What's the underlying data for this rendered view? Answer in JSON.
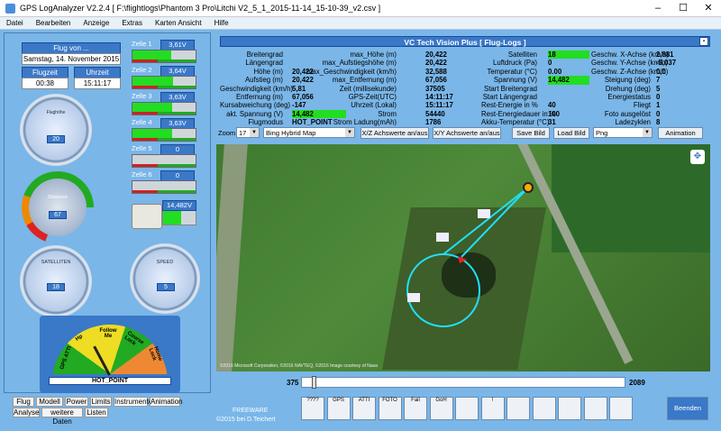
{
  "window": {
    "title": "GPS LogAnalyzer V2.2.4   [ F:\\flightlogs\\Phantom 3 Pro\\Litchi V2_5_1_2015-11-14_15-10-39_v2.csv ]"
  },
  "menu": [
    "Datei",
    "Bearbeiten",
    "Anzeige",
    "Extras",
    "Karten Ansicht",
    "Hilfe"
  ],
  "flight": {
    "header": "Flug von ...",
    "date": "Samstag, 14. November 2015",
    "flugzeit_label": "Flugzeit",
    "uhrzeit_label": "Uhrzeit",
    "flugzeit": "00:38",
    "uhrzeit": "15:11:17"
  },
  "cells": [
    {
      "label": "Zelle 1",
      "value": "3,61V",
      "level": 0.62
    },
    {
      "label": "Zelle 2",
      "value": "3,64V",
      "level": 0.64
    },
    {
      "label": "Zelle 3",
      "value": "3,63V",
      "level": 0.63
    },
    {
      "label": "Zelle 4",
      "value": "3,63V",
      "level": 0.63
    },
    {
      "label": "Zelle 5",
      "value": "0",
      "level": 0
    },
    {
      "label": "Zelle 6",
      "value": "0",
      "level": 0
    }
  ],
  "battery": {
    "value": "14,482V"
  },
  "gauges": {
    "speed_small": {
      "label": "Flughöhe",
      "value": "20"
    },
    "distance": {
      "label": "Distance",
      "value": "67"
    },
    "satellites": {
      "label": "SATELLITEN",
      "value": "18"
    },
    "speed": {
      "label": "SPEED",
      "value": "5"
    }
  },
  "mode": {
    "labels": [
      "GPS ATTI",
      "Hp",
      "Follow Me",
      "Course Lock",
      "Home Lock"
    ],
    "value": "HOT_POINT"
  },
  "tabs_row1": [
    "Flug",
    "Modell",
    "Power",
    "Limits",
    "Instrumente",
    "Animation"
  ],
  "tabs_row2": [
    "Analyse",
    "weitere Daten",
    "Listen"
  ],
  "vc_header": "VC Tech Vision Plus [ Flug-Logs ]",
  "col1": [
    [
      "Breitengrad",
      ""
    ],
    [
      "Längengrad",
      ""
    ],
    [
      "Höhe (m)",
      "20,422"
    ],
    [
      "Aufstieg (m)",
      "20,422"
    ],
    [
      "Geschwindigkeit (km/h)",
      "5,81"
    ],
    [
      "Entfernung (m)",
      "67,056"
    ],
    [
      "Kursabweichung (deg)",
      "-147"
    ],
    [
      "akt. Spannung (V)",
      "14,482"
    ],
    [
      "Flugmodus",
      "HOT_POINT"
    ]
  ],
  "col2": [
    [
      "max_Höhe (m)",
      "20,422"
    ],
    [
      "max_Aufstiegshöhe (m)",
      "20,422"
    ],
    [
      "max_Geschwindigkeit (km/h)",
      "32,588"
    ],
    [
      "max_Entfernung (m)",
      "67,056"
    ],
    [
      "Zeit (millisekunde)",
      "37505"
    ],
    [
      "GPS-Zeit(UTC)",
      "14:11:17"
    ],
    [
      "Uhrzeit (Lokal)",
      "15:11:17"
    ],
    [
      "Strom",
      "54440"
    ],
    [
      "Strom Ladung(mAh)",
      "1786"
    ]
  ],
  "col3": [
    [
      "Satelliten",
      "18"
    ],
    [
      "Luftdruck (Pa)",
      "0"
    ],
    [
      "Temperatur (°C)",
      "0.00"
    ],
    [
      "Spannung (V)",
      "14,482"
    ],
    [
      "Start Breitengrad",
      ""
    ],
    [
      "Start Längengrad",
      ""
    ],
    [
      "Rest-Energie in %",
      "40"
    ],
    [
      "Rest-Energiedauer in %",
      "100"
    ],
    [
      "Akku-Temperatur (°C)",
      "31"
    ]
  ],
  "col4": [
    [
      "Geschw. X-Achse (km/h)",
      "2,881"
    ],
    [
      "Geschw. Y-Achse (km/h)",
      "-5,037"
    ],
    [
      "Geschw. Z-Achse (km/h)",
      "0,0"
    ],
    [
      "Steigung (deg)",
      "7"
    ],
    [
      "Drehung (deg)",
      "5"
    ],
    [
      "Energiestatus",
      "0"
    ],
    [
      "Fliegt",
      "1"
    ],
    [
      "Foto ausgelöst",
      "0"
    ],
    [
      "Ladezyklen",
      "8"
    ]
  ],
  "controls": {
    "zoom_label": "Zoom",
    "zoom_value": "17",
    "map_type": "Bing Hybrid Map",
    "xz_btn": "X/Z Achswerte an/aus",
    "xy_btn": "X/Y Achswerte an/aus",
    "save_btn": "Save Bild",
    "load_btn": "Load Bild",
    "format": "Png",
    "anim_btn": "Animation"
  },
  "map": {
    "copyright": "©2016 Microsoft Corporation, ©2016 NAVTEQ, ©2016 Image courtesy of Nasa"
  },
  "slider": {
    "min": "375",
    "max": "2089",
    "position": 0.03
  },
  "footer": {
    "freeware": "FREEWARE",
    "copyright": "©2015  bei D.Teichert",
    "beenden": "Beenden"
  },
  "toolbar": [
    "????",
    "GPS",
    "ATTI",
    "FOTO",
    "Fail",
    "GoH",
    "",
    "!",
    "",
    "",
    "",
    "",
    ""
  ],
  "colors": {
    "accent": "#3a78c8",
    "panel": "#7ab6e8",
    "green": "#22dd22"
  }
}
